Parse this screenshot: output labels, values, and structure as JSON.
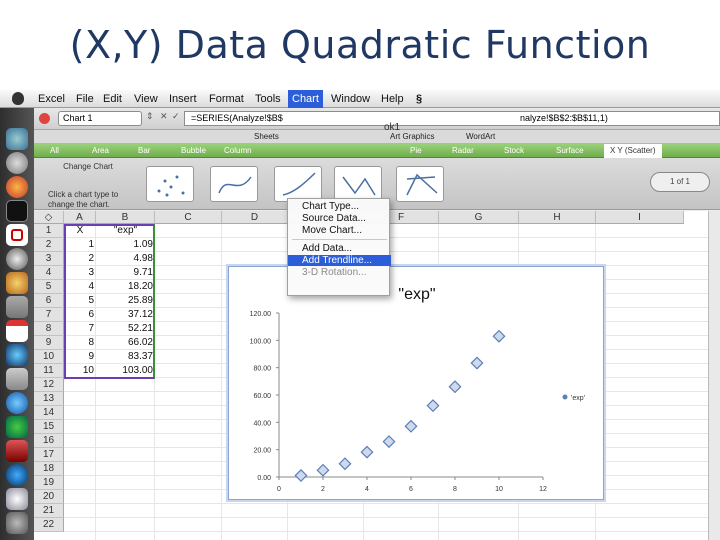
{
  "slide": {
    "title": "(X,Y) Data Quadratic Function"
  },
  "menubar": {
    "items": [
      "Excel",
      "File",
      "Edit",
      "View",
      "Insert",
      "Format",
      "Tools",
      "Chart",
      "Window",
      "Help"
    ],
    "script_glyph": "§",
    "active": "Chart"
  },
  "chart_menu": {
    "items": [
      {
        "label": "Chart Type...",
        "state": "normal"
      },
      {
        "label": "Source Data...",
        "state": "normal"
      },
      {
        "label": "Move Chart...",
        "state": "normal"
      },
      {
        "label": "Add Data...",
        "state": "normal"
      },
      {
        "label": "Add Trendline...",
        "state": "highlighted"
      },
      {
        "label": "3-D Rotation...",
        "state": "disabled"
      }
    ]
  },
  "formula_bar": {
    "name_box": "Chart 1",
    "formula_left": "=SERIES(Analyze!$B$",
    "formula_right": "nalyze!$B$2:$B$11,1)",
    "doc_title": "ok1"
  },
  "ribbon": {
    "tabs": [
      "Sheets",
      "Art Graphics",
      "WordArt"
    ],
    "gallery_tabs": [
      "All",
      "Area",
      "Bar",
      "Bubble",
      "Column",
      "Pie",
      "Radar",
      "Stock",
      "Surface",
      "X Y (Scatter)"
    ],
    "selected_gallery_tab": "X Y (Scatter)",
    "change_chart": "Change Chart",
    "help": "Click a chart type to change the chart.",
    "pager": "1 of 1"
  },
  "sheet": {
    "columns": [
      "A",
      "B",
      "C",
      "D",
      "E",
      "F",
      "G",
      "H",
      "I"
    ],
    "rows": [
      "1",
      "2",
      "3",
      "4",
      "5",
      "6",
      "7",
      "8",
      "9",
      "10",
      "11",
      "12",
      "13",
      "14",
      "15",
      "16",
      "17",
      "18",
      "19",
      "20",
      "21",
      "22"
    ],
    "header_x": "X",
    "header_y": "\"exp\"",
    "x_values": [
      "1",
      "2",
      "3",
      "4",
      "5",
      "6",
      "7",
      "8",
      "9",
      "10"
    ],
    "y_values": [
      "1.09",
      "4.98",
      "9.71",
      "18.20",
      "25.89",
      "37.12",
      "52.21",
      "66.02",
      "83.37",
      "103.00"
    ]
  },
  "chart_data": {
    "type": "scatter",
    "title": "\"exp\"",
    "series": [
      {
        "name": "'exp'",
        "x": [
          1,
          2,
          3,
          4,
          5,
          6,
          7,
          8,
          9,
          10
        ],
        "y": [
          1.09,
          4.98,
          9.71,
          18.2,
          25.89,
          37.12,
          52.21,
          66.02,
          83.37,
          103.0
        ]
      }
    ],
    "xlim": [
      0,
      12
    ],
    "ylim": [
      0,
      120
    ],
    "xticks": [
      "0",
      "2",
      "4",
      "6",
      "8",
      "10",
      "12"
    ],
    "yticks": [
      "0.00",
      "20.00",
      "40.00",
      "60.00",
      "80.00",
      "100.00",
      "120.00"
    ],
    "legend": "right",
    "marker_color": "#5b7fb7",
    "grid": false
  },
  "colors": {
    "menu_highlight": "#2b5ed8",
    "gallery_green": "#7fbf5a"
  }
}
